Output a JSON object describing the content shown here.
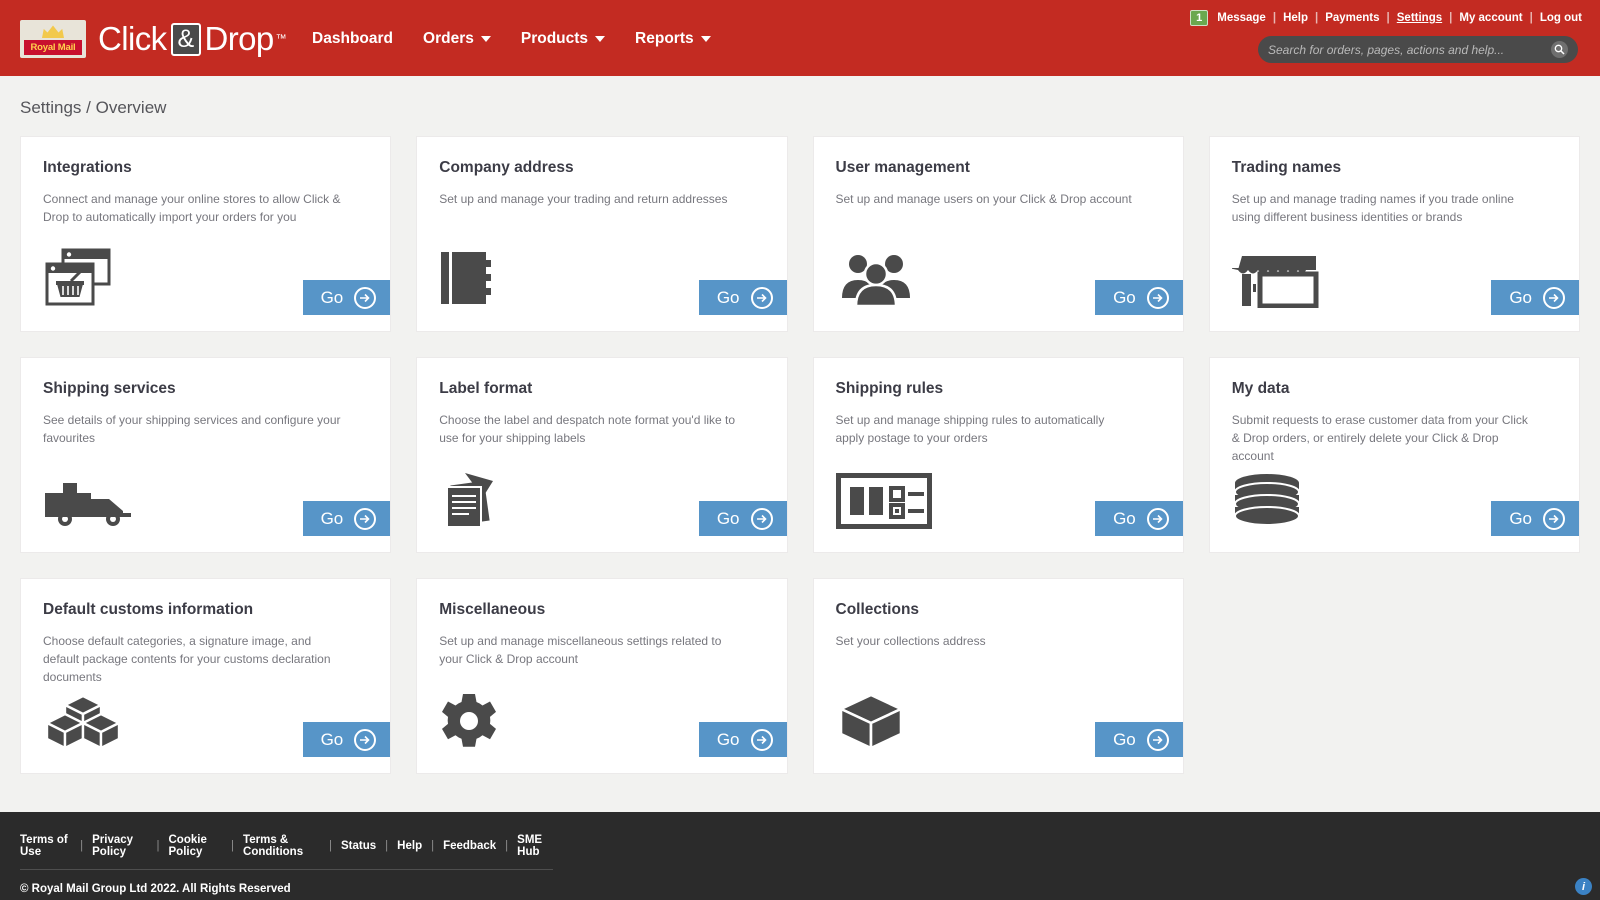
{
  "header": {
    "logo_text": "Royal Mail",
    "brand_click": "Click",
    "brand_amp": "&",
    "brand_drop": "Drop",
    "brand_tm": "™",
    "nav": [
      {
        "label": "Dashboard",
        "has_caret": false
      },
      {
        "label": "Orders",
        "has_caret": true
      },
      {
        "label": "Products",
        "has_caret": true
      },
      {
        "label": "Reports",
        "has_caret": true
      }
    ],
    "message_count": "1",
    "utility": [
      {
        "label": "Message",
        "active": false
      },
      {
        "label": "Help",
        "active": false
      },
      {
        "label": "Payments",
        "active": false
      },
      {
        "label": "Settings",
        "active": true
      },
      {
        "label": "My account",
        "active": false
      },
      {
        "label": "Log out",
        "active": false
      }
    ],
    "search": {
      "placeholder": "Search for orders, pages, actions and help...",
      "value": "",
      "icon": "search-icon"
    },
    "brand_color": "#c32b22"
  },
  "page": {
    "breadcrumb": "Settings / Overview",
    "go_label": "Go",
    "accent_color": "#5795c8"
  },
  "cards": [
    {
      "title": "Integrations",
      "desc": "Connect and manage your online stores to allow Click & Drop to automatically import your orders for you",
      "icon": "browser-basket-icon",
      "go": "Go"
    },
    {
      "title": "Company address",
      "desc": "Set up and manage your trading and return addresses",
      "icon": "address-book-icon",
      "go": "Go"
    },
    {
      "title": "User management",
      "desc": "Set up and manage users on your Click & Drop account",
      "icon": "users-icon",
      "go": "Go"
    },
    {
      "title": "Trading names",
      "desc": "Set up and manage trading names if you trade online using different business identities or brands",
      "icon": "storefront-icon",
      "go": "Go"
    },
    {
      "title": "Shipping services",
      "desc": "See details of your shipping services and configure your favourites",
      "icon": "delivery-van-icon",
      "go": "Go"
    },
    {
      "title": "Label format",
      "desc": "Choose the label and despatch note format you'd like to use for your shipping labels",
      "icon": "documents-icon",
      "go": "Go"
    },
    {
      "title": "Shipping rules",
      "desc": "Set up and manage shipping rules to automatically apply postage to your orders",
      "icon": "rules-layout-icon",
      "go": "Go"
    },
    {
      "title": "My data",
      "desc": "Submit requests to erase customer data from your Click & Drop orders, or entirely delete your Click & Drop account",
      "icon": "database-icon",
      "go": "Go"
    },
    {
      "title": "Default customs information",
      "desc": "Choose default categories, a signature image, and default package contents for your customs declaration documents",
      "icon": "boxes-cubes-icon",
      "go": "Go"
    },
    {
      "title": "Miscellaneous",
      "desc": "Set up and manage miscellaneous settings related to your Click & Drop account",
      "icon": "gear-icon",
      "go": "Go"
    },
    {
      "title": "Collections",
      "desc": "Set your collections address",
      "icon": "cube-icon",
      "go": "Go"
    }
  ],
  "footer": {
    "links": [
      "Terms of Use",
      "Privacy Policy",
      "Cookie Policy",
      "Terms & Conditions",
      "Status",
      "Help",
      "Feedback",
      "SME Hub"
    ],
    "copyright": "© Royal Mail Group Ltd 2022. All Rights Reserved",
    "help_icon": "info-icon"
  }
}
